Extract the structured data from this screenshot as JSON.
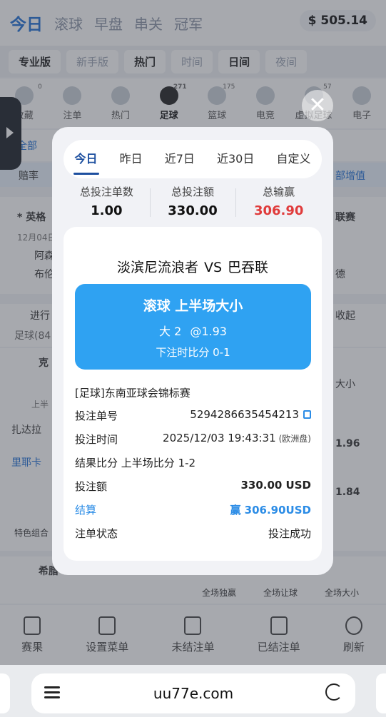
{
  "header": {
    "tabs": [
      "今日",
      "滚球",
      "早盘",
      "串关",
      "冠军"
    ],
    "balance": "$ 505.14"
  },
  "modes": [
    "专业版",
    "新手版",
    "热门",
    "时间",
    "日间",
    "夜间"
  ],
  "categories": [
    {
      "label": "收藏",
      "count": "0"
    },
    {
      "label": "注单",
      "count": ""
    },
    {
      "label": "热门",
      "count": ""
    },
    {
      "label": "足球",
      "count": "271"
    },
    {
      "label": "篮球",
      "count": "175"
    },
    {
      "label": "电竞",
      "count": ""
    },
    {
      "label": "虚拟足球",
      "count": "57"
    },
    {
      "label": "电子",
      "count": ""
    }
  ],
  "background": {
    "all": "全部",
    "odds_label": "赔率",
    "boost": "部增值",
    "league_left": "* 英格",
    "league_right": "联赛",
    "date": "12月04日",
    "team1": "阿森",
    "team2": "布伦",
    "right_team": "德",
    "live": "进行",
    "football_count": "足球(84",
    "collapse": "收起",
    "match_a": "克",
    "match_b": "扎达拉",
    "first_half": "上半",
    "red_card": "里耶卡",
    "special": "特色组合",
    "greek": "希腊",
    "col1": "全场独赢",
    "col2": "全场让球",
    "col3": "全场大小",
    "right_col": "大小",
    "odds1": "1.96",
    "odds2": "1.84"
  },
  "bottom_nav": [
    "赛果",
    "设置菜单",
    "未结注单",
    "已结注单",
    "刷新"
  ],
  "url": "uu77e.com",
  "modal": {
    "close": "✕",
    "date_tabs": [
      "今日",
      "昨日",
      "近7日",
      "近30日",
      "自定义"
    ],
    "summary": [
      {
        "label": "总投注单数",
        "value": "1.00"
      },
      {
        "label": "总投注额",
        "value": "330.00"
      },
      {
        "label": "总输赢",
        "value": "306.90"
      }
    ],
    "match": {
      "home": "淡滨尼流浪者",
      "vs": "VS",
      "away": "巴吞联"
    },
    "bet": {
      "title": "滚球 上半场大小",
      "pick": "大 2",
      "odds": "@1.93",
      "score_at_bet": "下注时比分 0-1"
    },
    "league": "[足球]东南亚球会锦标赛",
    "rows": {
      "bet_no_label": "投注单号",
      "bet_no": "5294286635454213",
      "bet_time_label": "投注时间",
      "bet_time": "2025/12/03 19:43:31",
      "bet_time_note": "(欧洲盘)",
      "result_label": "结果比分",
      "result": "上半场比分 1-2",
      "amount_label": "投注额",
      "amount": "330.00 USD",
      "settle_label": "结算",
      "settle": "赢 306.90USD",
      "status_label": "注单状态",
      "status": "投注成功"
    }
  }
}
